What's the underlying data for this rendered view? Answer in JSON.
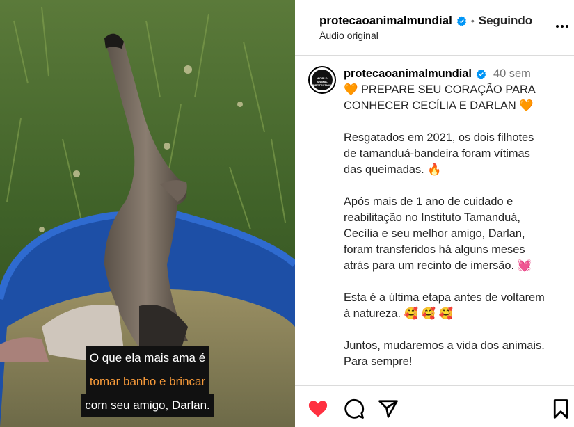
{
  "video": {
    "subtitles": [
      "O que ela mais ama é",
      "tomar banho e brincar",
      "com seu amigo, Darlan."
    ]
  },
  "header": {
    "username": "protecaoanimalmundial",
    "separator": "•",
    "follow_status": "Seguindo",
    "audio": "Áudio original"
  },
  "post": {
    "avatar_text": [
      "WORLD",
      "ANIMAL",
      "PROTECTION"
    ],
    "username": "protecaoanimalmundial",
    "time": "40 sem",
    "lines": [
      "🧡 PREPARE SEU CORAÇÃO PARA",
      "CONHECER CECÍLIA E DARLAN 🧡",
      "",
      "Resgatados em 2021, os dois filhotes",
      "de tamanduá-bandeira foram vítimas",
      "das queimadas. 🔥",
      "",
      "Após mais de 1 ano de cuidado e",
      "reabilitação no Instituto Tamanduá,",
      "Cecília e seu melhor amigo, Darlan,",
      "foram transferidos há alguns meses",
      "atrás para um recinto de imersão. 💓",
      "",
      "Esta é a última etapa antes de voltarem",
      "à natureza. 🥰 🥰 🥰",
      "",
      "Juntos, mudaremos a vida dos animais.",
      "Para sempre!"
    ]
  },
  "actions": {
    "like_icon": "heart-filled-icon",
    "comment_icon": "comment-icon",
    "share_icon": "share-icon",
    "save_icon": "bookmark-icon"
  },
  "colors": {
    "like": "#ff3040",
    "verified": "#0095f6",
    "subtitle_highlight": "#f79a3a"
  }
}
